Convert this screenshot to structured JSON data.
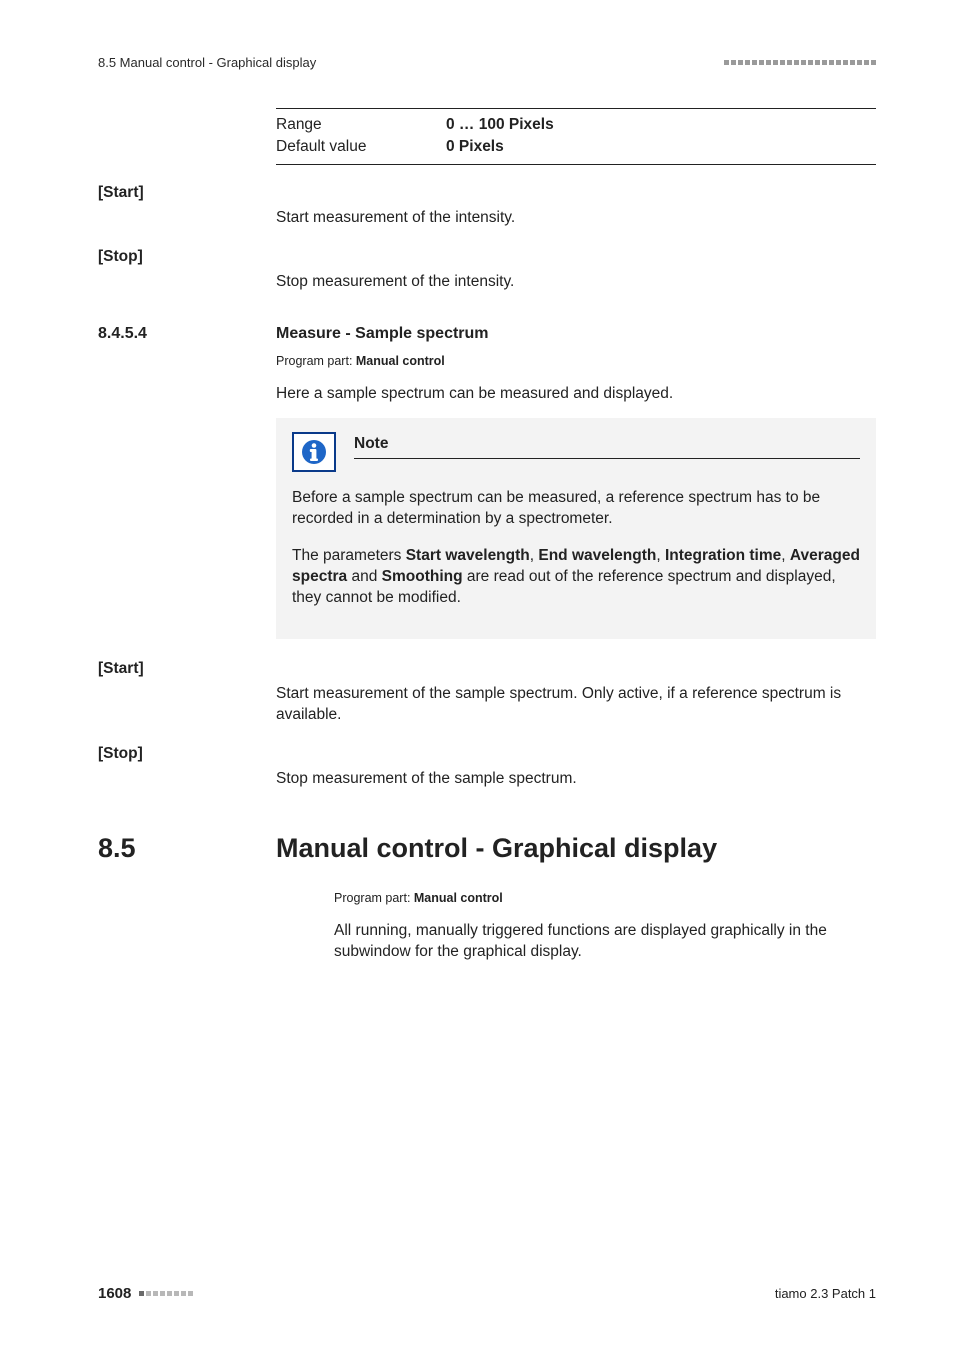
{
  "runhead": {
    "section": "8.5 Manual control - Graphical display"
  },
  "rangeBlock": {
    "rangeLabel": "Range",
    "rangeValue": "0 … 100 Pixels",
    "defaultLabel": "Default value",
    "defaultValue": "0 Pixels"
  },
  "startA": {
    "term": "[Start]",
    "desc": "Start measurement of the intensity."
  },
  "stopA": {
    "term": "[Stop]",
    "desc": "Stop measurement of the intensity."
  },
  "sec8454": {
    "num": "8.4.5.4",
    "title": "Measure - Sample spectrum",
    "progPartLabel": "Program part: ",
    "progPartValue": "Manual control",
    "intro": "Here a sample spectrum can be measured and displayed."
  },
  "note": {
    "title": "Note",
    "p1": "Before a sample spectrum can be measured, a reference spectrum has to be recorded in a determination by a spectrometer.",
    "p2a": "The parameters ",
    "p2b1": "Start wavelength",
    "p2c1": ", ",
    "p2b2": "End wavelength",
    "p2c2": ", ",
    "p2b3": "Integration time",
    "p2c3": ", ",
    "p2b4": "Averaged spectra",
    "p2c4": " and ",
    "p2b5": "Smoothing",
    "p2d": " are read out of the reference spectrum and displayed, they cannot be modified."
  },
  "startB": {
    "term": "[Start]",
    "desc": "Start measurement of the sample spectrum. Only active, if a reference spectrum is available."
  },
  "stopB": {
    "term": "[Stop]",
    "desc": "Stop measurement of the sample spectrum."
  },
  "sec85": {
    "num": "8.5",
    "title": "Manual control - Graphical display",
    "progPartLabel": "Program part: ",
    "progPartValue": "Manual control",
    "body": "All running, manually triggered functions are displayed graphically in the subwindow for the graphical display."
  },
  "footer": {
    "page": "1608",
    "product": "tiamo 2.3 Patch 1"
  }
}
